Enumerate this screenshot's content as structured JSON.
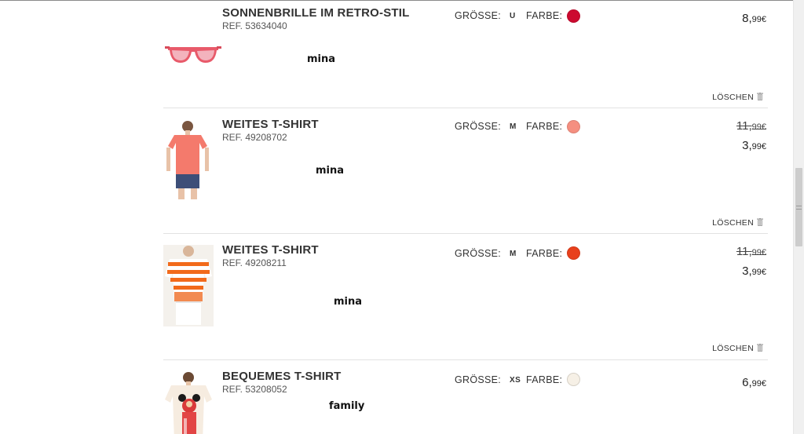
{
  "labels": {
    "size": "GRÖSSE:",
    "color": "FARBE:",
    "delete": "LÖSCHEN"
  },
  "items": [
    {
      "title": "SONNENBRILLE IM RETRO-STIL",
      "ref": "REF. 53634040",
      "tag": "mina",
      "size": "U",
      "color_hex": "#cc0a2f",
      "old_price": null,
      "price_main": "8,",
      "price_cents": "99€",
      "image": "sunglasses-icon"
    },
    {
      "title": "WEITES T-SHIRT",
      "ref": "REF. 49208702",
      "tag": "mina",
      "size": "M",
      "color_hex": "#f58f80",
      "old_price_main": "11,",
      "old_price_cents": "99€",
      "price_main": "3,",
      "price_cents": "99€",
      "image": "coral-tshirt-model"
    },
    {
      "title": "WEITES T-SHIRT",
      "ref": "REF. 49208211",
      "tag": "mina",
      "size": "M",
      "color_hex": "#e8401c",
      "old_price_main": "11,",
      "old_price_cents": "99€",
      "price_main": "3,",
      "price_cents": "99€",
      "image": "striped-tshirt-model"
    },
    {
      "title": "BEQUEMES T-SHIRT",
      "ref": "REF. 53208052",
      "tag": "family",
      "size": "XS",
      "color_hex": "#f6f0e6",
      "old_price": null,
      "price_main": "6,",
      "price_cents": "99€",
      "image": "printed-tshirt-model"
    }
  ]
}
